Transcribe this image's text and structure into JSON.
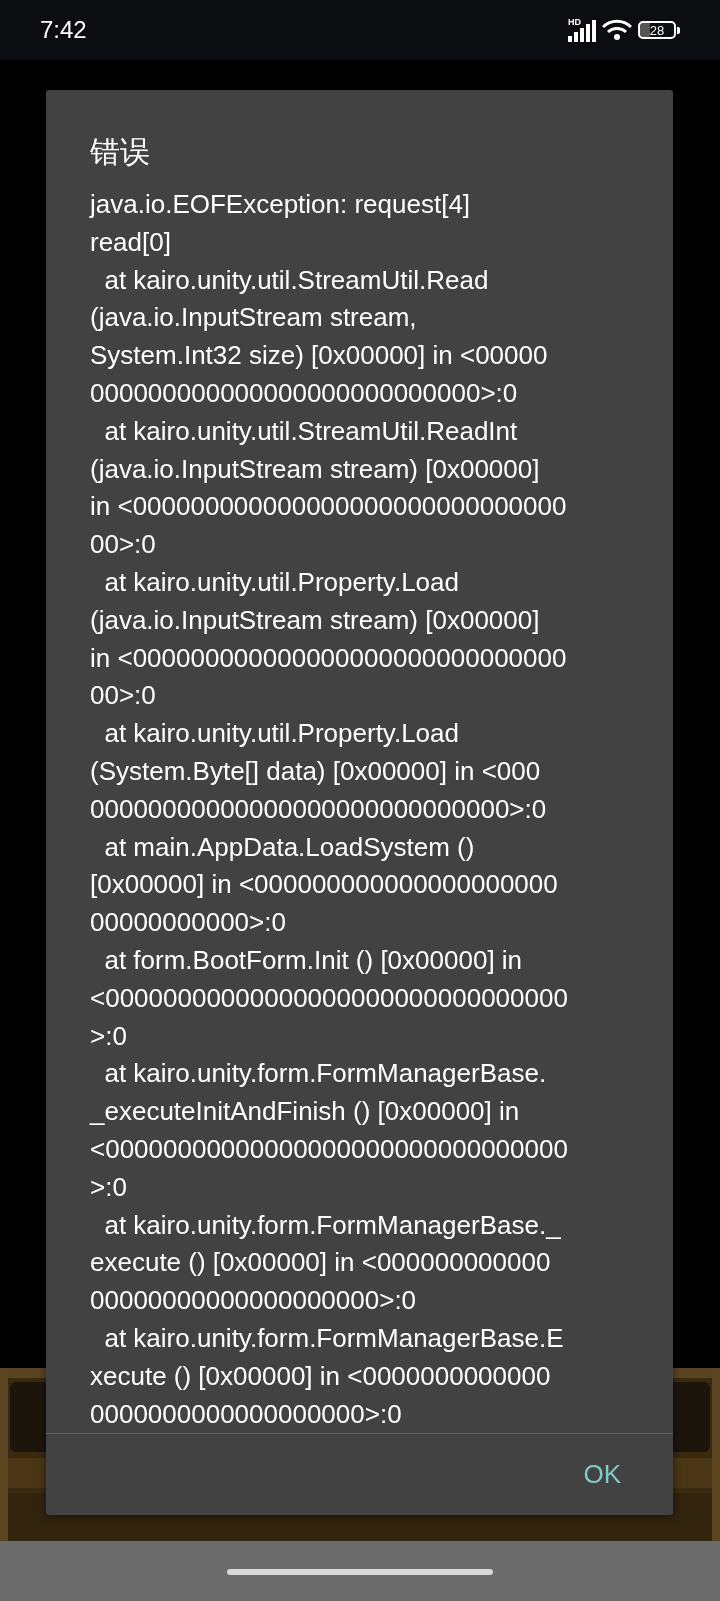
{
  "status_bar": {
    "time": "7:42",
    "network_label": "HD",
    "battery": "28"
  },
  "dialog": {
    "title": "错误",
    "message_lines": [
      "java.io.EOFException: request[4]",
      "read[0]",
      "  at kairo.unity.util.StreamUtil.Read",
      "(java.io.InputStream stream,",
      "System.Int32 size) [0x00000] in <00000",
      "000000000000000000000000000>:0",
      "  at kairo.unity.util.StreamUtil.ReadInt",
      "(java.io.InputStream stream) [0x00000]",
      "in <000000000000000000000000000000",
      "00>:0",
      "  at kairo.unity.util.Property.Load",
      "(java.io.InputStream stream) [0x00000]",
      "in <000000000000000000000000000000",
      "00>:0",
      "  at kairo.unity.util.Property.Load",
      "(System.Byte[] data) [0x00000] in <000",
      "00000000000000000000000000000>:0",
      "  at main.AppData.LoadSystem ()",
      "[0x00000] in <000000000000000000000",
      "00000000000>:0",
      "  at form.BootForm.Init () [0x00000] in",
      "<00000000000000000000000000000000",
      ">:0",
      "  at kairo.unity.form.FormManagerBase.",
      "_executeInitAndFinish () [0x00000] in",
      "<00000000000000000000000000000000",
      ">:0",
      "  at kairo.unity.form.FormManagerBase._",
      "execute () [0x00000] in <000000000000",
      "00000000000000000000>:0",
      "  at kairo.unity.form.FormManagerBase.E",
      "xecute () [0x00000] in <0000000000000",
      "0000000000000000000>:0"
    ],
    "button": "OK"
  }
}
